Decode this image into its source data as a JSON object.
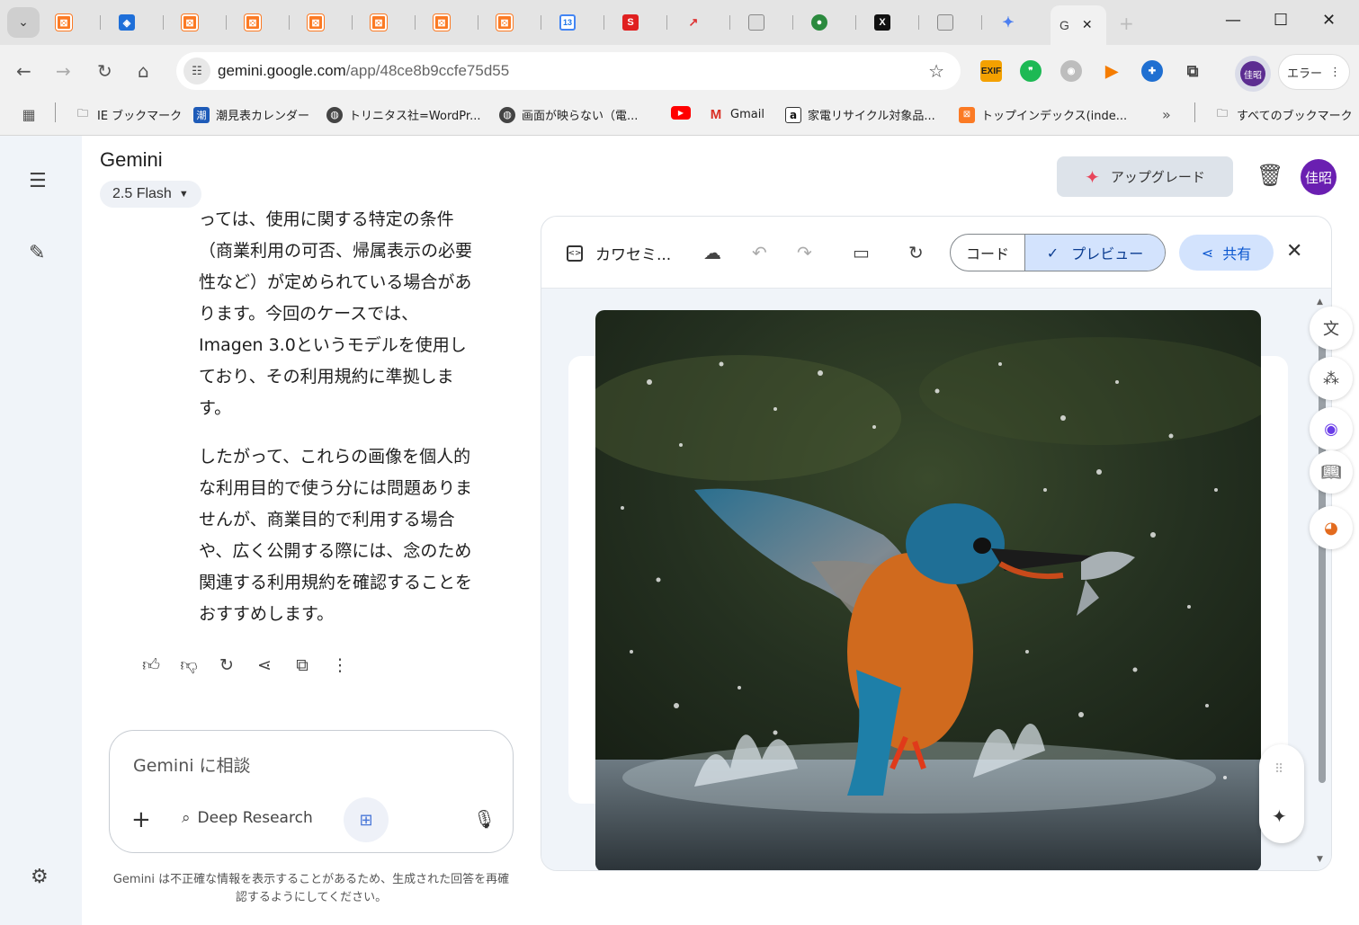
{
  "browser": {
    "active_tab_letter": "G",
    "url_host": "gemini.google.com",
    "url_path": "/app/48ce8b9ccfe75d55",
    "ext_exif": "EXIF",
    "error_label": "エラー",
    "profile_initials": "佳昭",
    "bookmarks": [
      "IE ブックマーク",
      "潮見表カレンダー",
      "トリニタス社=WordPr...",
      "画面が映らない（電...",
      "",
      "Gmail",
      "家電リサイクル対象品...",
      "トップインデックス(inde...",
      "すべてのブックマーク"
    ],
    "bookmark_icon_shio": "潮",
    "bookmark_icon_amazon": "a",
    "cal_tab_num": "13"
  },
  "app": {
    "title": "Gemini",
    "model": "2.5 Flash",
    "upgrade_label": "アップグレード",
    "avatar_initials": "佳昭"
  },
  "chat": {
    "paragraph1": "っては、使用に関する特定の条件（商業利用の可否、帰属表示の必要性など）が定められている場合があります。今回のケースでは、Imagen 3.0というモデルを使用しており、その利用規約に準拠します。",
    "paragraph2": "したがって、これらの画像を個人的な利用目的で使う分には問題ありませんが、商業目的で利用する場合や、広く公開する際には、念のため関連する利用規約を確認することをおすすめします。"
  },
  "input": {
    "placeholder": "Gemini に相談",
    "deep_research": "Deep Research"
  },
  "disclaimer": "Gemini は不正確な情報を表示することがあるため、生成された回答を再確認するようにしてください。",
  "canvas": {
    "doc_title": "カワセミ...",
    "code_label": "コード",
    "preview_label": "プレビュー",
    "share_label": "共有"
  },
  "colors": {
    "accent_blue": "#d3e3fd",
    "rail_bg": "#f0f4f9",
    "avatar_purple": "#6a1fb1",
    "upgrade_spark": "#e8455b"
  }
}
